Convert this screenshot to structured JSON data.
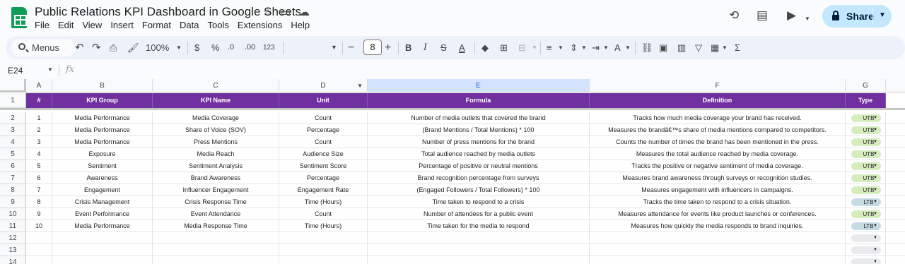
{
  "title": "Public Relations KPI Dashboard in Google Sheets",
  "menu": [
    "File",
    "Edit",
    "View",
    "Insert",
    "Format",
    "Data",
    "Tools",
    "Extensions",
    "Help"
  ],
  "share_label": "Share",
  "toolbar": {
    "search_label": "Menus",
    "zoom": "100%",
    "currency": "$",
    "percent": "%",
    "decrease_decimal": ".0",
    "increase_decimal": ".00",
    "number_format": "123",
    "font_size": "8"
  },
  "name_box": "E24",
  "fx_label": "fx",
  "col_letters": [
    "A",
    "B",
    "C",
    "D",
    "E",
    "F",
    "G"
  ],
  "row_numbers": [
    "1",
    "2",
    "3",
    "4",
    "5",
    "6",
    "7",
    "8",
    "9",
    "10",
    "11",
    "12",
    "13",
    "14"
  ],
  "headers": [
    "#",
    "KPI Group",
    "KPI Name",
    "Unit",
    "Formula",
    "Definition",
    "Type"
  ],
  "rows": [
    {
      "num": "1",
      "group": "Media Performance",
      "name": "Media Coverage",
      "unit": "Count",
      "formula": "Number of media outlets that covered the brand",
      "definition": "Tracks how much media coverage your brand has received.",
      "type": "UTB"
    },
    {
      "num": "2",
      "group": "Media Performance",
      "name": "Share of Voice (SOV)",
      "unit": "Percentage",
      "formula": "(Brand Mentions / Total Mentions) * 100",
      "definition": "Measures the brandâ€™s share of media mentions compared to competitors.",
      "type": "UTB"
    },
    {
      "num": "3",
      "group": "Media Performance",
      "name": "Press Mentions",
      "unit": "Count",
      "formula": "Number of press mentions for the brand",
      "definition": "Counts the number of times the brand has been mentioned in the press.",
      "type": "UTB"
    },
    {
      "num": "4",
      "group": "Exposure",
      "name": "Media Reach",
      "unit": "Audience Size",
      "formula": "Total audience reached by media outlets",
      "definition": "Measures the total audience reached by media coverage.",
      "type": "UTB"
    },
    {
      "num": "5",
      "group": "Sentiment",
      "name": "Sentiment Analysis",
      "unit": "Sentiment Score",
      "formula": "Percentage of positive or neutral mentions",
      "definition": "Tracks the positive or negative sentiment of media coverage.",
      "type": "UTB"
    },
    {
      "num": "6",
      "group": "Awareness",
      "name": "Brand Awareness",
      "unit": "Percentage",
      "formula": "Brand recognition percentage from surveys",
      "definition": "Measures brand awareness through surveys or recognition studies.",
      "type": "UTB"
    },
    {
      "num": "7",
      "group": "Engagement",
      "name": "Influencer Engagement",
      "unit": "Engagement Rate",
      "formula": "(Engaged Followers / Total Followers) * 100",
      "definition": "Measures engagement with influencers in campaigns.",
      "type": "UTB"
    },
    {
      "num": "8",
      "group": "Crisis Management",
      "name": "Crisis Response Time",
      "unit": "Time (Hours)",
      "formula": "Time taken to respond to a crisis",
      "definition": "Tracks the time taken to respond to a crisis situation.",
      "type": "LTB"
    },
    {
      "num": "9",
      "group": "Event Performance",
      "name": "Event Attendance",
      "unit": "Count",
      "formula": "Number of attendees for a public event",
      "definition": "Measures attendance for events like product launches or conferences.",
      "type": "UTB"
    },
    {
      "num": "10",
      "group": "Media Performance",
      "name": "Media Response Time",
      "unit": "Time (Hours)",
      "formula": "Time taken for the media to respond",
      "definition": "Measures how quickly the media responds to brand inquiries.",
      "type": "LTB"
    }
  ],
  "colors": {
    "header_bg": "#7030a0",
    "utb_chip": "#d4edbc",
    "ltb_chip": "#c6dbe1",
    "selected_col": "#d3e3fd"
  }
}
